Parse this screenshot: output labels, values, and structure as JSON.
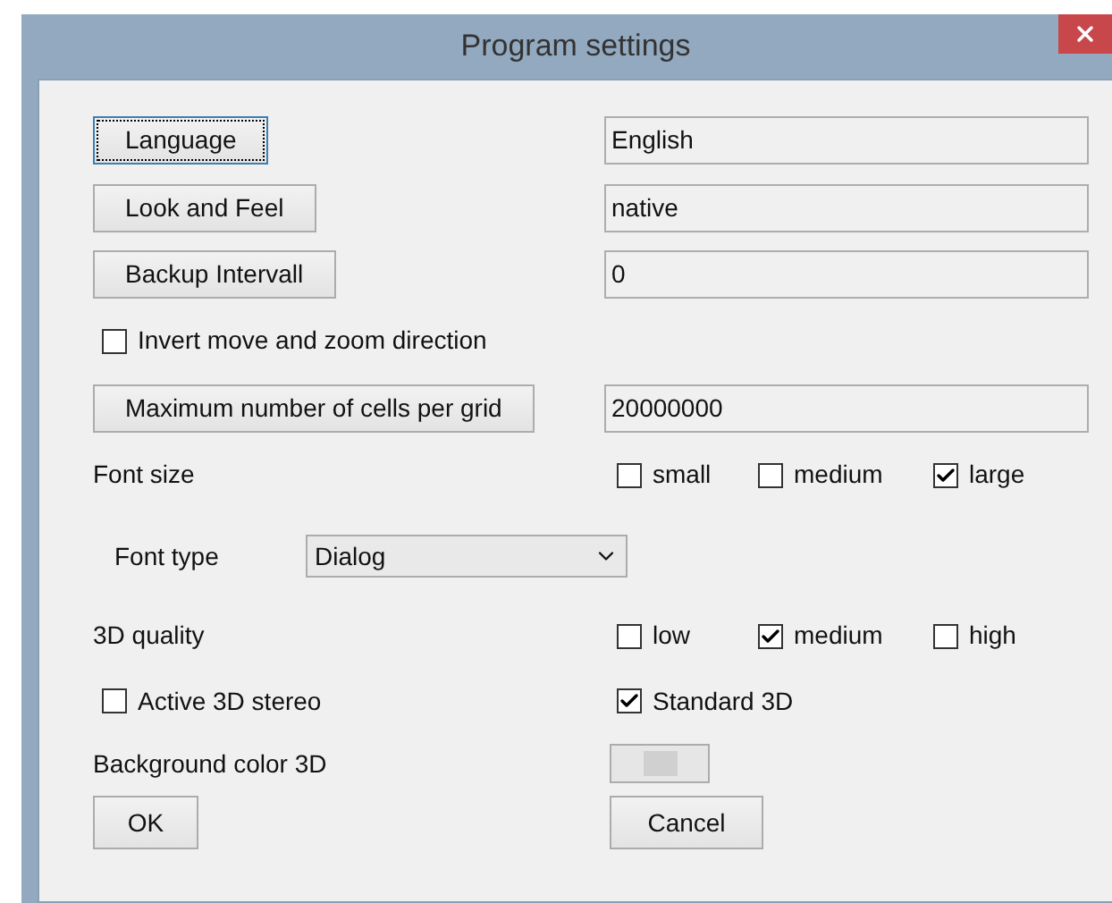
{
  "window": {
    "title": "Program settings"
  },
  "fields": [
    {
      "button": "Language",
      "value": "English",
      "focused": true
    },
    {
      "button": "Look and Feel",
      "value": "native",
      "focused": false
    },
    {
      "button": "Backup Intervall",
      "value": "0",
      "focused": false
    }
  ],
  "invert": {
    "label": "Invert move and zoom direction",
    "checked": false
  },
  "max_cells": {
    "button": "Maximum number of cells per grid",
    "value": "20000000",
    "focused": false
  },
  "font_size": {
    "label": "Font size",
    "options": [
      {
        "label": "small",
        "checked": false
      },
      {
        "label": "medium",
        "checked": false
      },
      {
        "label": "large",
        "checked": true
      }
    ]
  },
  "font_type": {
    "label": "Font type",
    "value": "Dialog"
  },
  "quality": {
    "label": "3D quality",
    "options": [
      {
        "label": "low",
        "checked": false
      },
      {
        "label": "medium",
        "checked": true
      },
      {
        "label": "high",
        "checked": false
      }
    ]
  },
  "stereo": [
    {
      "label": "Active 3D stereo",
      "checked": false
    },
    {
      "label": "Standard 3D",
      "checked": true
    }
  ],
  "background_color": {
    "label": "Background color 3D"
  },
  "buttons": [
    "OK",
    "Cancel"
  ]
}
